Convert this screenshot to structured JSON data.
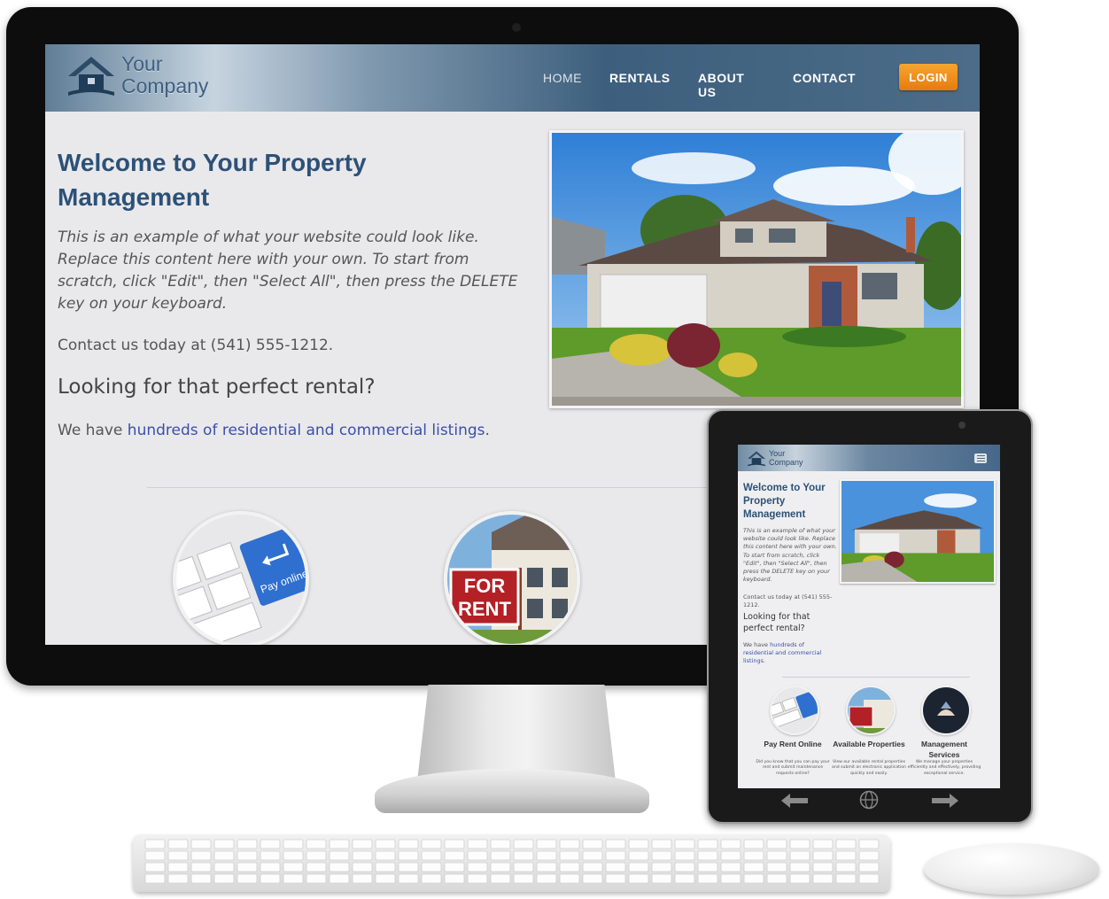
{
  "site": {
    "logo_line1": "Your",
    "logo_line2": "Company",
    "nav": [
      "HOME",
      "RENTALS",
      "ABOUT US",
      "CONTACT"
    ],
    "login_label": "LOGIN",
    "welcome_title": "Welcome to Your Property Management",
    "intro": "This is an example of what your website could look like. Replace this content here with your own. To start from scratch, click \"Edit\", then \"Select All\", then press the DELETE key on your keyboard.",
    "contact": "Contact us today at (541) 555-1212.",
    "rental_heading": "Looking for that perfect rental?",
    "listings_prefix": "We have ",
    "listings_link": "hundreds of residential and commercial listings",
    "listings_suffix": ".",
    "pay_online_key": "Pay online",
    "for_rent_sign": [
      "FOR",
      "RENT"
    ]
  },
  "tablet": {
    "features": [
      {
        "title": "Pay Rent Online",
        "desc": "Did you know that you can pay your rent and submit maintenance requests online?"
      },
      {
        "title": "Available Properties",
        "desc": "View our available rental properties and submit an electronic application quickly and easily."
      },
      {
        "title": "Management Services",
        "desc": "We manage your properties efficiently and effectively, providing exceptional service."
      }
    ]
  },
  "colors": {
    "brand_blue": "#2d5177",
    "link_blue": "#3b4fa8",
    "login_orange": "#f08a1c",
    "header_steel": "#4c6c88"
  },
  "icons": [
    "house-logo-icon",
    "hamburger-menu-icon",
    "back-arrow-icon",
    "globe-icon",
    "forward-arrow-icon"
  ]
}
